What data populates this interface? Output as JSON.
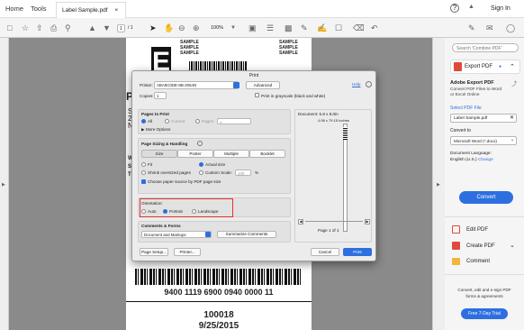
{
  "topbar": {
    "home": "Home",
    "tools": "Tools",
    "doc_tab": "Label Sample.pdf",
    "close": "×",
    "help": "?",
    "bell": "🔔",
    "signin": "Sign In"
  },
  "toolbar": {
    "page_current": "1",
    "page_total": "/ 1",
    "zoom": "100%"
  },
  "label": {
    "sample_lines": [
      "SAMPLE",
      "SAMPLE",
      "SAMPLE"
    ],
    "letter_big": "E",
    "side_letters": [
      "P",
      "S",
      "2",
      "N",
      "W",
      "S",
      "T"
    ],
    "tracking": "9400 1119 6900 0940 0000 11",
    "number": "100018",
    "date": "9/25/2015"
  },
  "dialog": {
    "title": "Print",
    "printer_label": "Printer:",
    "printer_value": "ABA9C0DE-8B-2054N",
    "advanced": "Advanced",
    "help": "Help",
    "copies_label": "Copies:",
    "copies_value": "1",
    "grayscale": "Print in grayscale (black and white)",
    "pages_to_print": "Pages to Print",
    "all": "All",
    "current": "Current",
    "pages": "Pages",
    "pages_range": "1",
    "more_options": "More Options",
    "sizing": "Page Sizing & Handling",
    "size_tabs": [
      "Size",
      "Poster",
      "Multiple",
      "Booklet"
    ],
    "fit": "Fit",
    "actual_size": "Actual size",
    "shrink": "Shrink oversized pages",
    "custom_scale": "Custom Scale:",
    "custom_value": "100",
    "percent": "%",
    "choose_paper": "Choose paper source by PDF page size",
    "orientation": "Orientation:",
    "auto": "Auto",
    "portrait": "Portrait",
    "landscape": "Landscape",
    "comments_forms": "Comments & Forms",
    "comments_value": "Document and Markups",
    "summarize": "Summarize Comments",
    "document_size": "Document: 5.8 x 8.0in",
    "preview_size": "4.08 x 79.15 Inches",
    "page_of": "Page 1 of 1",
    "page_setup": "Page Setup...",
    "printer_btn": "Printer...",
    "cancel": "Cancel",
    "print": "Print"
  },
  "rpanel": {
    "search": "Search 'Combine PDF'",
    "export_pdf": "Export PDF",
    "adobe_export": "Adobe Export PDF",
    "export_desc": [
      "Convert PDF Files to Word",
      "or Excel Online"
    ],
    "select_pdf": "Select PDF File",
    "file": "Label Sample.pdf",
    "convert_to": "Convert to",
    "format": "Microsoft Word (*.docx)",
    "doc_lang_label": "Document Language:",
    "doc_lang": "English (U.S.)",
    "change": "Change",
    "convert": "Convert",
    "edit_pdf": "Edit PDF",
    "create_pdf": "Create PDF",
    "comment": "Comment",
    "promo": [
      "Convert, edit and e-sign PDF",
      "forms & agreements"
    ],
    "trial": "Free 7-Day Trial"
  },
  "colors": {
    "accent": "#2d6fe0",
    "highlight": "#e0322f",
    "export": "#e04a3a",
    "comment": "#f0b73a"
  }
}
